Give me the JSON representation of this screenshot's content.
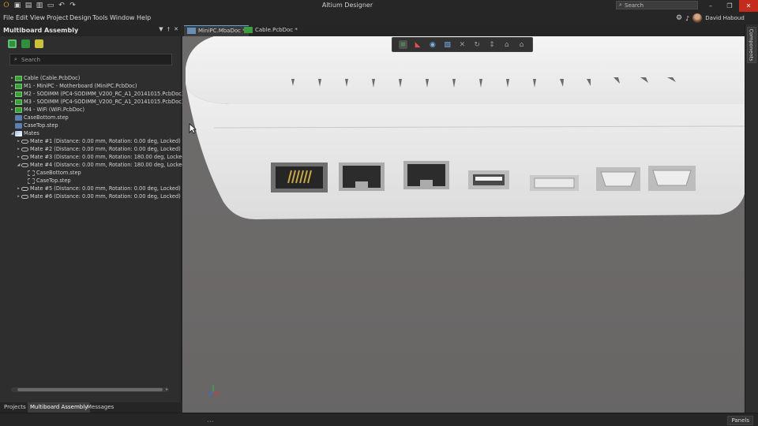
{
  "app": {
    "title": "Altium Designer"
  },
  "search": {
    "placeholder": "Search"
  },
  "menu": [
    "File",
    "Edit",
    "View",
    "Project",
    "Design",
    "Tools",
    "Window",
    "Help"
  ],
  "user": {
    "name": "David Haboud"
  },
  "panel": {
    "title": "Multiboard Assembly",
    "search_placeholder": "Search",
    "tree": [
      {
        "label": "Cable (Cable.PcbDoc)",
        "depth": 0,
        "twisty": "closed",
        "icon": "board-icon"
      },
      {
        "label": "M1 - MiniPC - Motherboard (MiniPC.PcbDoc)",
        "depth": 0,
        "twisty": "closed",
        "icon": "board-icon"
      },
      {
        "label": "M2 - SODIMM (PC4-SODIMM_V200_RC_A1_20141015.PcbDoc)",
        "depth": 0,
        "twisty": "closed",
        "icon": "board-icon"
      },
      {
        "label": "M3 - SODIMM (PC4-SODIMM_V200_RC_A1_20141015.PcbDoc)",
        "depth": 0,
        "twisty": "closed",
        "icon": "board-icon"
      },
      {
        "label": "M4 - WiFi (WiFi.PcbDoc)",
        "depth": 0,
        "twisty": "closed",
        "icon": "board-icon"
      },
      {
        "label": "CaseBottom.step",
        "depth": 0,
        "twisty": "none",
        "icon": "step-icon"
      },
      {
        "label": "CaseTop.step",
        "depth": 0,
        "twisty": "none",
        "icon": "step-icon"
      },
      {
        "label": "Mates",
        "depth": 0,
        "twisty": "open",
        "icon": "mates-icon"
      },
      {
        "label": "Mate #1 (Distance: 0.00 mm, Rotation: 0.00 deg, Locked)",
        "depth": 1,
        "twisty": "closed",
        "icon": "mate-icon"
      },
      {
        "label": "Mate #2 (Distance: 0.00 mm, Rotation: 0.00 deg, Locked)",
        "depth": 1,
        "twisty": "closed",
        "icon": "mate-icon"
      },
      {
        "label": "Mate #3 (Distance: 0.00 mm, Rotation: 180.00 deg, Locked)",
        "depth": 1,
        "twisty": "closed",
        "icon": "mate-icon"
      },
      {
        "label": "Mate #4 (Distance: 0.00 mm, Rotation: 180.00 deg, Locked)",
        "depth": 1,
        "twisty": "open",
        "icon": "mate-icon"
      },
      {
        "label": "CaseBottom.step",
        "depth": 2,
        "twisty": "none",
        "icon": "sub-step-icon"
      },
      {
        "label": "CaseTop.step",
        "depth": 2,
        "twisty": "none",
        "icon": "sub-step-icon"
      },
      {
        "label": "Mate #5 (Distance: 0.00 mm, Rotation: 0.00 deg, Locked)",
        "depth": 1,
        "twisty": "closed",
        "icon": "mate-icon"
      },
      {
        "label": "Mate #6 (Distance: 0.00 mm, Rotation: 0.00 deg, Locked)",
        "depth": 1,
        "twisty": "closed",
        "icon": "mate-icon"
      }
    ]
  },
  "bottom_tabs": [
    {
      "label": "Projects",
      "active": false
    },
    {
      "label": "Multiboard Assembly",
      "active": true
    },
    {
      "label": "Messages",
      "active": false
    }
  ],
  "doc_tabs": [
    {
      "label": "MiniPC.MbaDoc *",
      "active": true
    },
    {
      "label": "Cable.PcbDoc *",
      "active": false
    }
  ],
  "right_tab": {
    "label": "Components"
  },
  "status": {
    "panels_label": "Panels"
  },
  "colors": {
    "accent": "#5da3e0",
    "board_green": "#3e9b3e",
    "close_red": "#c42b1c"
  }
}
